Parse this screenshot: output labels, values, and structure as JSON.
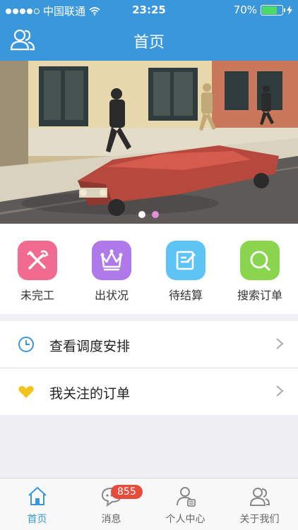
{
  "status": {
    "carrier": "中国联通",
    "time": "23:25",
    "battery": "70%",
    "signal_icon": "signal-dots-icon",
    "wifi_icon": "wifi-icon",
    "battery_icon": "battery-icon",
    "charge_icon": "charging-bolt-icon"
  },
  "nav": {
    "title": "首页",
    "left_icon": "users-icon"
  },
  "banner": {
    "active_page": 2,
    "page_count": 2
  },
  "quick_actions": [
    {
      "label": "未完工",
      "icon": "tools-icon",
      "color": "#f06b8f"
    },
    {
      "label": "出状况",
      "icon": "crown-icon",
      "color": "#b079ea"
    },
    {
      "label": "待结算",
      "icon": "edit-icon",
      "color": "#5ec3f5"
    },
    {
      "label": "搜索订单",
      "icon": "search-icon",
      "color": "#8bd44e"
    }
  ],
  "list": [
    {
      "label": "查看调度安排",
      "icon": "clock-icon"
    },
    {
      "label": "我关注的订单",
      "icon": "heart-icon"
    }
  ],
  "tabs": [
    {
      "label": "首页",
      "icon": "home-icon",
      "active": true
    },
    {
      "label": "消息",
      "icon": "chat-icon",
      "badge": "855"
    },
    {
      "label": "个人中心",
      "icon": "person-icon"
    },
    {
      "label": "关于我们",
      "icon": "about-users-icon"
    }
  ],
  "colors": {
    "primary": "#3b97dc",
    "badge": "#e74b3c",
    "heart": "#f2c31a"
  }
}
